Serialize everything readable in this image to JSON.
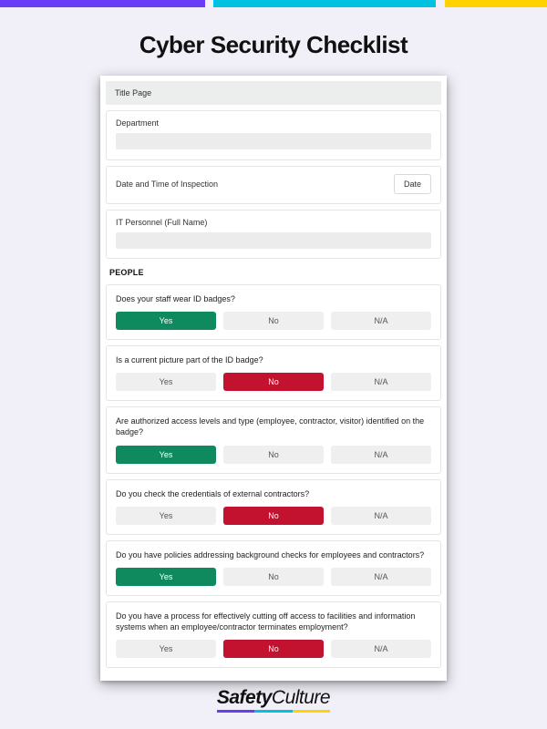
{
  "page_title": "Cyber Security Checklist",
  "section_header": "Title Page",
  "fields": {
    "department": {
      "label": "Department"
    },
    "datetime": {
      "label": "Date and Time of Inspection",
      "button": "Date"
    },
    "personnel": {
      "label": "IT Personnel (Full Name)"
    }
  },
  "group_label": "PEOPLE",
  "choice_labels": {
    "yes": "Yes",
    "no": "No",
    "na": "N/A"
  },
  "questions": [
    {
      "text": "Does your staff wear ID badges?",
      "selected": "yes"
    },
    {
      "text": "Is a current picture part of the ID badge?",
      "selected": "no"
    },
    {
      "text": "Are authorized access levels and type (employee, contractor, visitor) identified on the badge?",
      "selected": "yes"
    },
    {
      "text": "Do you check the credentials of external contractors?",
      "selected": "no"
    },
    {
      "text": "Do you have policies addressing background checks for employees and contractors?",
      "selected": "yes"
    },
    {
      "text": "Do you have a process for effectively cutting off access to facilities and information systems when an employee/contractor terminates employment?",
      "selected": "no"
    }
  ],
  "brand": {
    "bold": "Safety",
    "light": "Culture"
  }
}
